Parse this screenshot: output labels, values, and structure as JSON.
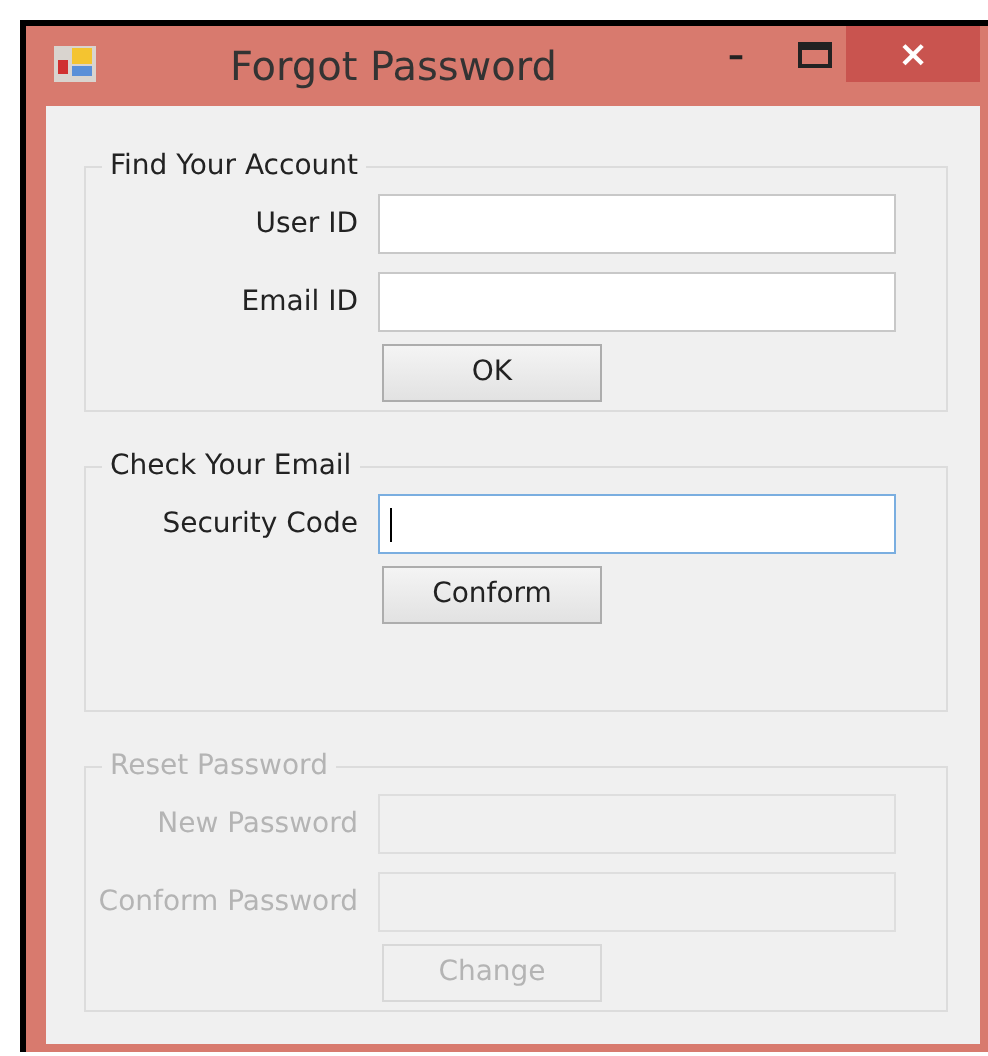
{
  "window": {
    "title": "Forgot Password",
    "controls": [
      "–",
      "×"
    ]
  },
  "groups": [
    {
      "title": "Find Your Account",
      "disabled": false,
      "fields": [
        {
          "label": "User ID",
          "focused": false
        },
        {
          "label": "Email ID",
          "focused": false
        }
      ],
      "button": "OK"
    },
    {
      "title": "Check Your Email",
      "disabled": false,
      "fields": [
        {
          "label": "Security Code",
          "focused": true
        }
      ],
      "button": "Conform"
    },
    {
      "title": "Reset Password",
      "disabled": true,
      "fields": [
        {
          "label": "New Password",
          "focused": false
        },
        {
          "label": "Conform Password",
          "focused": false
        }
      ],
      "button": "Change"
    }
  ]
}
